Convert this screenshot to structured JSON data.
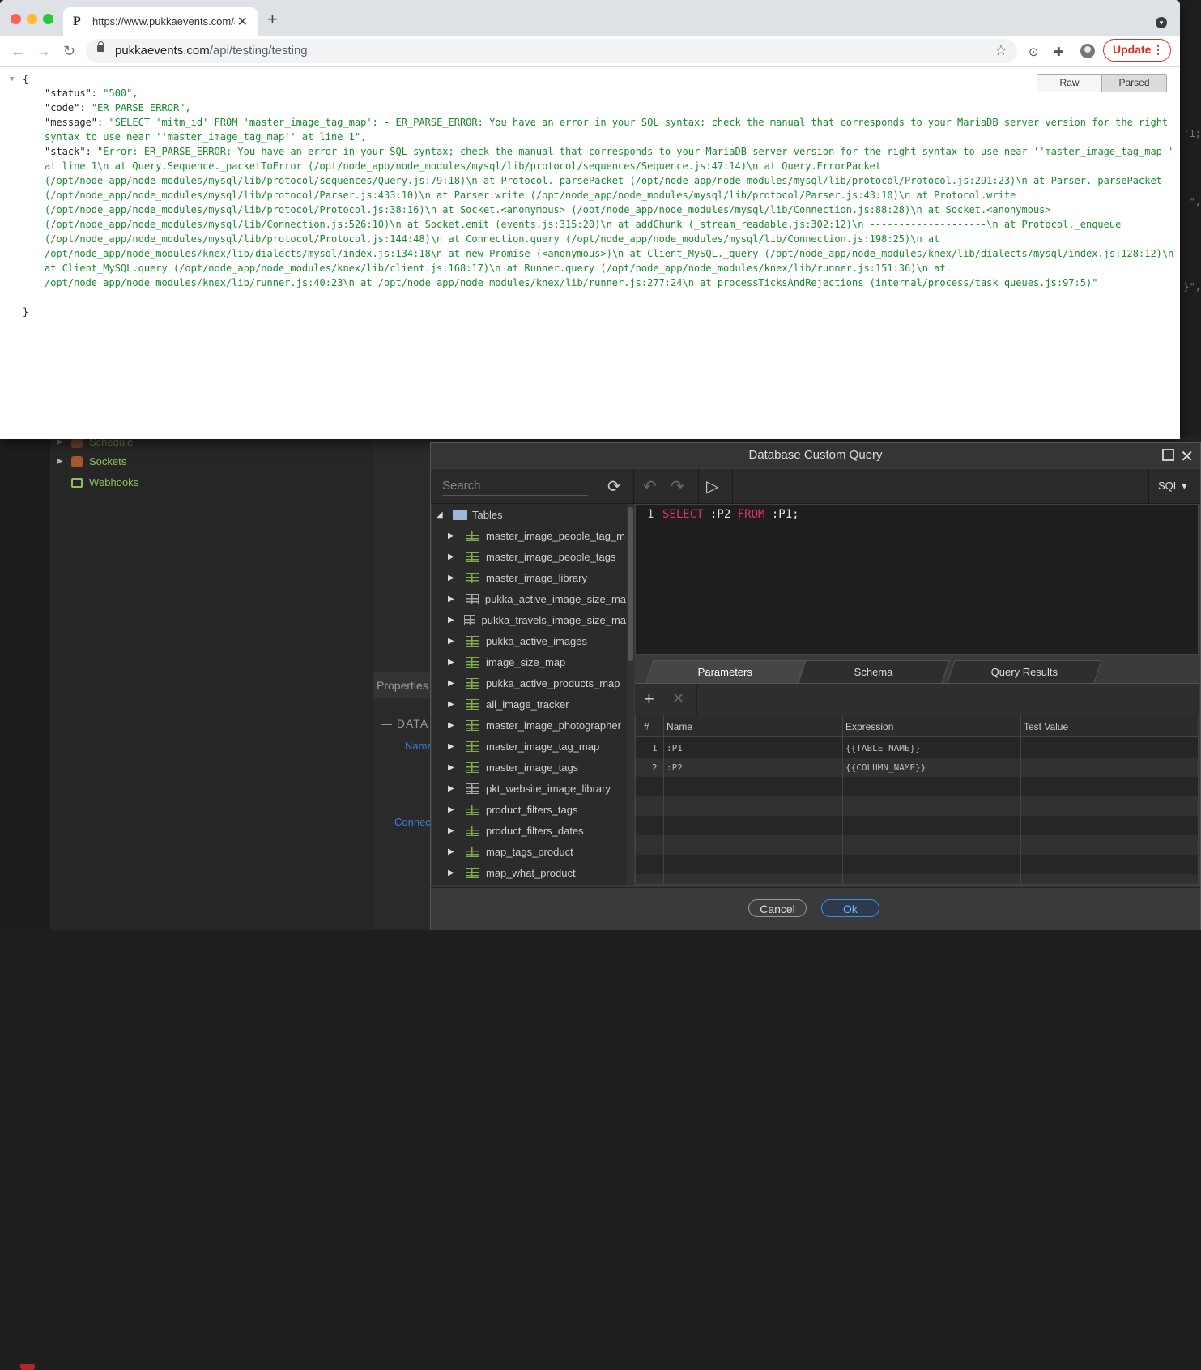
{
  "browser": {
    "tab_title": "https://www.pukkaevents.com/api/testing/testing",
    "favicon": "P",
    "url_host": "pukkaevents.com",
    "url_path": "/api/testing/testing",
    "update_label": "Update",
    "view_toggle": {
      "raw": "Raw",
      "parsed": "Parsed"
    }
  },
  "json_view": {
    "open_brace": "{",
    "close_brace": "}",
    "lines": [
      {
        "key": "\"status\"",
        "value": "\"500\","
      },
      {
        "key": "\"code\"",
        "value": "\"ER_PARSE_ERROR\","
      },
      {
        "key": "\"message\"",
        "value": "\"SELECT 'mitm_id' FROM 'master_image_tag_map'; - ER_PARSE_ERROR: You have an error in your SQL syntax; check the manual that corresponds to your MariaDB server version for the right syntax to use near ''master_image_tag_map'' at line 1\","
      },
      {
        "key": "\"stack\"",
        "value": "\"Error: ER_PARSE_ERROR: You have an error in your SQL syntax; check the manual that corresponds to your MariaDB server version for the right syntax to use near ''master_image_tag_map'' at line 1\\n    at Query.Sequence._packetToError (/opt/node_app/node_modules/mysql/lib/protocol/sequences/Sequence.js:47:14)\\n    at Query.ErrorPacket (/opt/node_app/node_modules/mysql/lib/protocol/sequences/Query.js:79:18)\\n    at Protocol._parsePacket (/opt/node_app/node_modules/mysql/lib/protocol/Protocol.js:291:23)\\n    at Parser._parsePacket (/opt/node_app/node_modules/mysql/lib/protocol/Parser.js:433:10)\\n    at Parser.write (/opt/node_app/node_modules/mysql/lib/protocol/Parser.js:43:10)\\n    at Protocol.write (/opt/node_app/node_modules/mysql/lib/protocol/Protocol.js:38:16)\\n    at Socket.<anonymous> (/opt/node_app/node_modules/mysql/lib/Connection.js:88:28)\\n    at Socket.<anonymous> (/opt/node_app/node_modules/mysql/lib/Connection.js:526:10)\\n    at Socket.emit (events.js:315:20)\\n    at addChunk (_stream_readable.js:302:12)\\n    --------------------\\n    at Protocol._enqueue (/opt/node_app/node_modules/mysql/lib/protocol/Protocol.js:144:48)\\n    at Connection.query (/opt/node_app/node_modules/mysql/lib/Connection.js:198:25)\\n    at /opt/node_app/node_modules/knex/lib/dialects/mysql/index.js:134:18\\n    at new Promise (<anonymous>)\\n    at Client_MySQL._query (/opt/node_app/node_modules/knex/lib/dialects/mysql/index.js:128:12)\\n    at Client_MySQL.query (/opt/node_app/node_modules/knex/lib/client.js:168:17)\\n    at Runner.query (/opt/node_app/node_modules/knex/lib/runner.js:151:36)\\n    at /opt/node_app/node_modules/knex/lib/runner.js:40:23\\n    at /opt/node_app/node_modules/knex/lib/runner.js:277:24\\n    at processTicksAndRejections (internal/process/task_queues.js:97:5)\""
      }
    ]
  },
  "ide": {
    "tree": [
      {
        "label": "Schedule"
      },
      {
        "label": "Sockets"
      },
      {
        "label": "Webhooks"
      }
    ],
    "properties_label": "Properties",
    "data_heading": "DATA",
    "name_label": "Name",
    "connection_label": "Connec",
    "right_fragments": [
      "'1;",
      "\",",
      "}\","
    ]
  },
  "dialog": {
    "title": "Database Custom Query",
    "search_placeholder": "Search",
    "language": "SQL",
    "tree_root": "Tables",
    "tables": [
      {
        "name": "master_image_people_tag_m",
        "type": "table"
      },
      {
        "name": "master_image_people_tags",
        "type": "table"
      },
      {
        "name": "master_image_library",
        "type": "table"
      },
      {
        "name": "pukka_active_image_size_ma",
        "type": "view"
      },
      {
        "name": "pukka_travels_image_size_ma",
        "type": "view"
      },
      {
        "name": "pukka_active_images",
        "type": "table"
      },
      {
        "name": "image_size_map",
        "type": "table"
      },
      {
        "name": "pukka_active_products_map",
        "type": "table"
      },
      {
        "name": "all_image_tracker",
        "type": "table"
      },
      {
        "name": "master_image_photographer",
        "type": "table"
      },
      {
        "name": "master_image_tag_map",
        "type": "table"
      },
      {
        "name": "master_image_tags",
        "type": "table"
      },
      {
        "name": "pkt_website_image_library",
        "type": "view"
      },
      {
        "name": "product_filters_tags",
        "type": "table"
      },
      {
        "name": "product_filters_dates",
        "type": "table"
      },
      {
        "name": "map_tags_product",
        "type": "table"
      },
      {
        "name": "map_what_product",
        "type": "table"
      }
    ],
    "editor": {
      "line_number": "1",
      "kw_select": "SELECT",
      "col": " :P2 ",
      "kw_from": "FROM",
      "table": " :P1;"
    },
    "tabs": [
      "Parameters",
      "Schema",
      "Query Results"
    ],
    "grid_headers": {
      "num": "#",
      "name": "Name",
      "expression": "Expression",
      "test_value": "Test Value"
    },
    "params": [
      {
        "num": "1",
        "name": ":P1",
        "expression": "{{TABLE_NAME}}",
        "test_value": ""
      },
      {
        "num": "2",
        "name": ":P2",
        "expression": "{{COLUMN_NAME}}",
        "test_value": ""
      }
    ],
    "cancel_label": "Cancel",
    "ok_label": "Ok"
  }
}
